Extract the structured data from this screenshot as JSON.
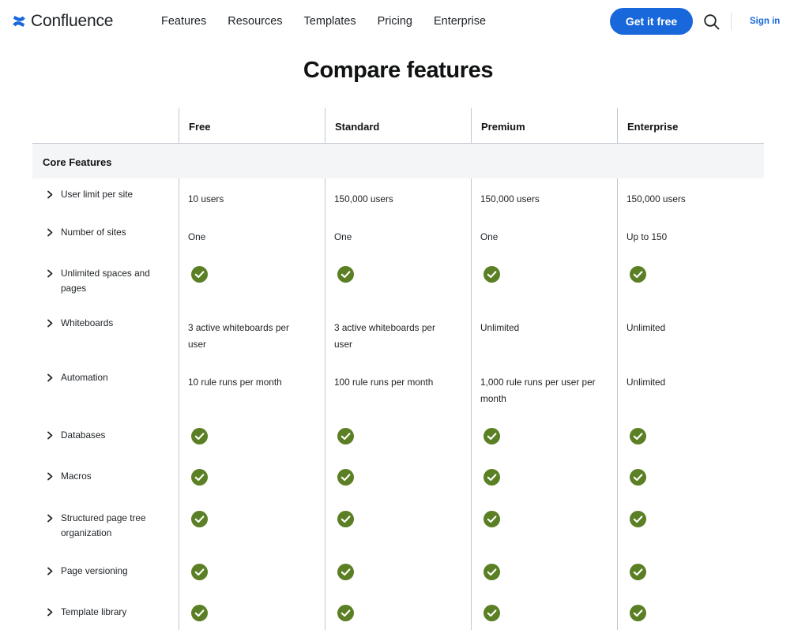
{
  "header": {
    "brand": "Confluence",
    "nav": [
      "Features",
      "Resources",
      "Templates",
      "Pricing",
      "Enterprise"
    ],
    "cta_label": "Get it free",
    "signin_label": "Sign in"
  },
  "page": {
    "title": "Compare features"
  },
  "table": {
    "plans": [
      "Free",
      "Standard",
      "Premium",
      "Enterprise"
    ],
    "section": "Core Features",
    "check_color": "#5b7f24",
    "rows": [
      {
        "feature": "User limit per site",
        "values": [
          "10 users",
          "150,000 users",
          "150,000 users",
          "150,000 users"
        ]
      },
      {
        "feature": "Number of sites",
        "values": [
          "One",
          "One",
          "One",
          "Up to 150"
        ]
      },
      {
        "feature": "Unlimited spaces and pages",
        "values": [
          "check",
          "check",
          "check",
          "check"
        ]
      },
      {
        "feature": "Whiteboards",
        "values": [
          "3 active whiteboards per user",
          "3 active whiteboards per user",
          "Unlimited",
          "Unlimited"
        ]
      },
      {
        "feature": "Automation",
        "values": [
          "10 rule runs per month",
          "100 rule runs per month",
          "1,000 rule runs per user per month",
          "Unlimited"
        ]
      },
      {
        "feature": "Databases",
        "values": [
          "check",
          "check",
          "check",
          "check"
        ]
      },
      {
        "feature": "Macros",
        "values": [
          "check",
          "check",
          "check",
          "check"
        ]
      },
      {
        "feature": "Structured page tree organization",
        "values": [
          "check",
          "check",
          "check",
          "check"
        ]
      },
      {
        "feature": "Page versioning",
        "values": [
          "check",
          "check",
          "check",
          "check"
        ]
      },
      {
        "feature": "Template library",
        "values": [
          "check",
          "check",
          "check",
          "check"
        ]
      }
    ]
  }
}
